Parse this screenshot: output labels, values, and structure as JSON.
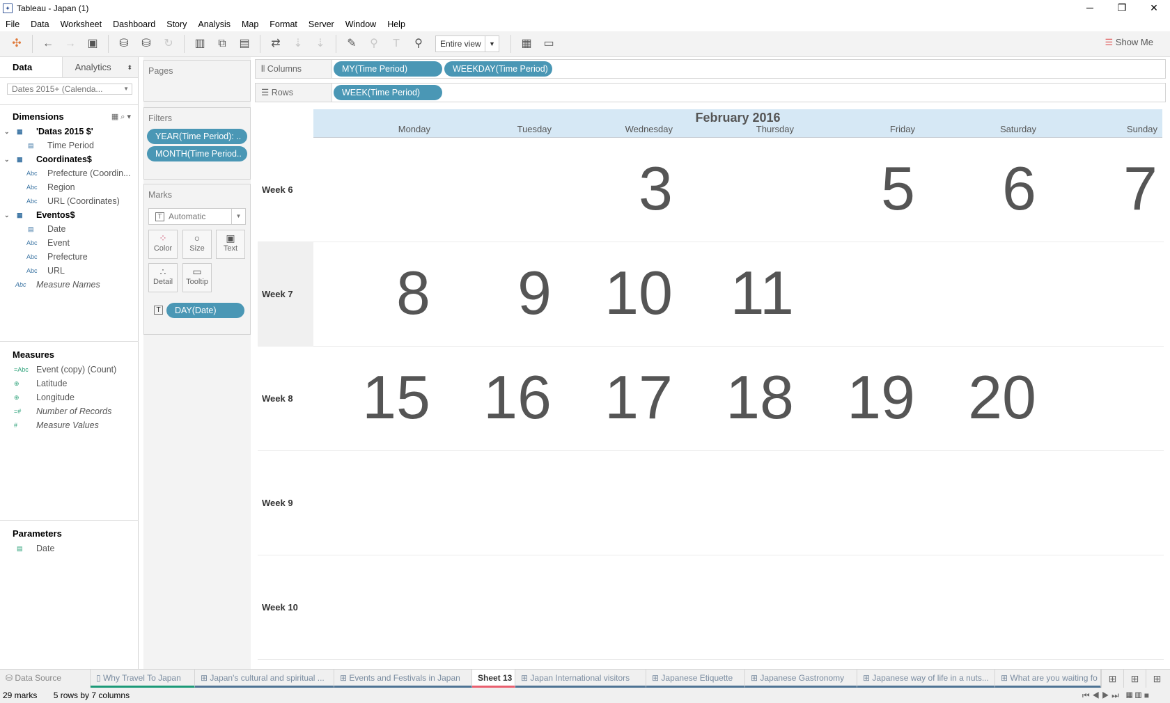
{
  "window": {
    "title": "Tableau - Japan (1)"
  },
  "menu": [
    "File",
    "Data",
    "Worksheet",
    "Dashboard",
    "Story",
    "Analysis",
    "Map",
    "Format",
    "Server",
    "Window",
    "Help"
  ],
  "toolbar": {
    "view_select": "Entire view",
    "show_me": "Show Me"
  },
  "left_pane": {
    "tabs": [
      "Data",
      "Analytics"
    ],
    "datasource": "Dates 2015+ (Calenda...",
    "dimensions_label": "Dimensions",
    "dimensions": [
      {
        "type": "table",
        "label": "'Datas 2015 $'"
      },
      {
        "type": "date",
        "label": "Time Period"
      },
      {
        "type": "table",
        "label": "Coordinates$"
      },
      {
        "type": "abc",
        "label": "Prefecture (Coordin..."
      },
      {
        "type": "abc",
        "label": "Region"
      },
      {
        "type": "abc",
        "label": "URL (Coordinates)"
      },
      {
        "type": "table",
        "label": "Eventos$"
      },
      {
        "type": "date",
        "label": "Date"
      },
      {
        "type": "abc",
        "label": "Event"
      },
      {
        "type": "abc",
        "label": "Prefecture"
      },
      {
        "type": "abc",
        "label": "URL"
      },
      {
        "type": "abc-top",
        "label": "Measure Names"
      }
    ],
    "abc_icon": "Abc",
    "measures_label": "Measures",
    "measures": [
      {
        "icon": "=Abc",
        "label": "Event (copy) (Count)",
        "italic": false
      },
      {
        "icon": "globe",
        "label": "Latitude",
        "italic": false
      },
      {
        "icon": "globe",
        "label": "Longitude",
        "italic": false
      },
      {
        "icon": "=#",
        "label": "Number of Records",
        "italic": true
      },
      {
        "icon": "#",
        "label": "Measure Values",
        "italic": true
      }
    ],
    "parameters_label": "Parameters",
    "parameters": [
      {
        "icon": "date",
        "label": "Date"
      }
    ]
  },
  "cards": {
    "pages": "Pages",
    "filters": "Filters",
    "filter_pills": [
      "YEAR(Time Period): ..",
      "MONTH(Time Period.."
    ],
    "marks": "Marks",
    "mark_type": "Automatic",
    "mark_buttons": [
      "Color",
      "Size",
      "Text",
      "Detail",
      "Tooltip"
    ],
    "mark_pill": "DAY(Date)"
  },
  "shelves": {
    "columns_label": "Columns",
    "columns": [
      "MY(Time Period)",
      "WEEKDAY(Time Period)"
    ],
    "rows_label": "Rows",
    "rows": [
      "WEEK(Time Period)"
    ]
  },
  "view": {
    "month": "February 2016",
    "weekdays": [
      "Monday",
      "Tuesday",
      "Wednesday",
      "Thursday",
      "Friday",
      "Saturday",
      "Sunday"
    ],
    "weeks": [
      {
        "label": "Week 6",
        "days": [
          null,
          null,
          "3",
          null,
          "5",
          "6",
          "7"
        ]
      },
      {
        "label": "Week 7",
        "days": [
          "8",
          "9",
          "10",
          "11",
          null,
          null,
          null
        ]
      },
      {
        "label": "Week 8",
        "days": [
          "15",
          "16",
          "17",
          "18",
          "19",
          "20",
          null
        ]
      },
      {
        "label": "Week 9",
        "days": [
          null,
          null,
          null,
          null,
          null,
          null,
          null
        ]
      },
      {
        "label": "Week 10",
        "days": [
          null,
          null,
          null,
          null,
          null,
          null,
          null
        ]
      }
    ]
  },
  "sheet_tabs": [
    {
      "label": "Data Source",
      "kind": "ds"
    },
    {
      "label": "Why Travel To Japan",
      "kind": "story"
    },
    {
      "label": "Japan's cultural and spiritual ...",
      "kind": "dash"
    },
    {
      "label": "Events and Festivals in Japan",
      "kind": "dash"
    },
    {
      "label": "Sheet 13",
      "kind": "active"
    },
    {
      "label": "Japan International visitors",
      "kind": "dash"
    },
    {
      "label": "Japanese Etiquette",
      "kind": "dash"
    },
    {
      "label": "Japanese Gastronomy",
      "kind": "dash"
    },
    {
      "label": "Japanese way of life in a nuts...",
      "kind": "dash"
    },
    {
      "label": "What are you waiting fo",
      "kind": "dash"
    }
  ],
  "status": {
    "marks": "29 marks",
    "dims": "5 rows by 7 columns"
  }
}
